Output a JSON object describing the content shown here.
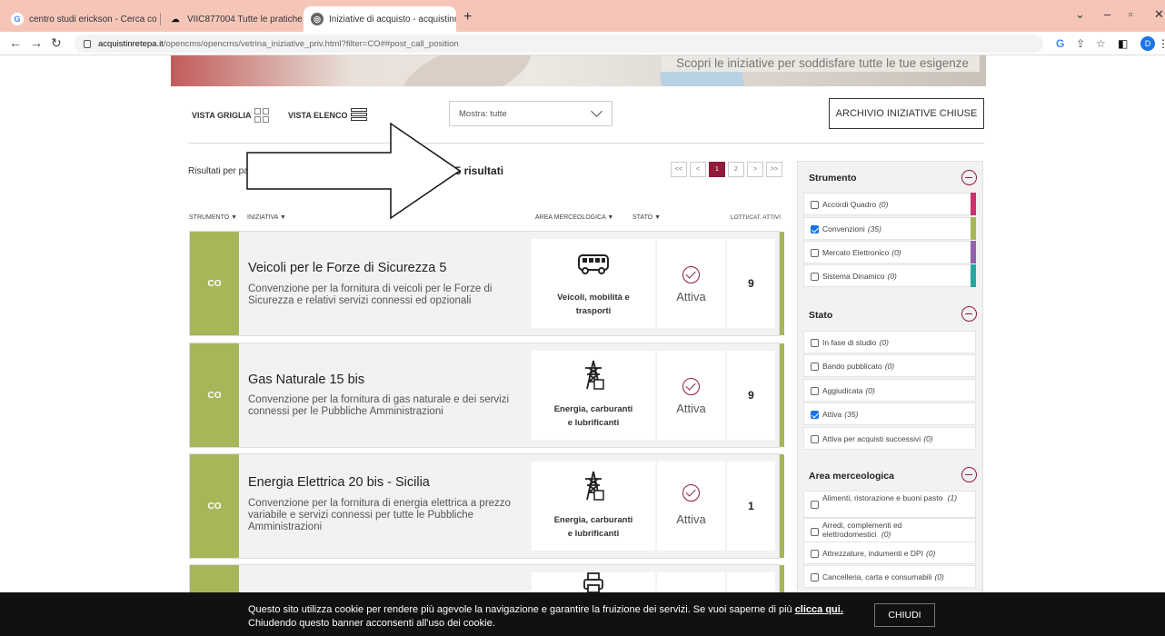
{
  "browser": {
    "tabs": [
      {
        "label": "centro studi erickson - Cerca con"
      },
      {
        "label": "VIIC877004 Tutte le pratiche"
      },
      {
        "label": "Iniziative di acquisto - acquistinr"
      }
    ],
    "url_domain": "acquistinretepa.it",
    "url_path": "/opencms/opencms/vetrina_iniziative_priv.html?filter=CO##post_call_position",
    "profile_initial": "D"
  },
  "banner": {
    "tagline": "Scopri le iniziative per soddisfare tutte le tue esigenze"
  },
  "toolbar": {
    "grid_label": "VISTA GRIGLIA",
    "list_label": "VISTA ELENCO",
    "select_value": "Mostra: tutte",
    "archive_button": "ARCHIVIO INIZIATIVE CHIUSE"
  },
  "results": {
    "per_page_label": "Risultati per pa",
    "count_label": "35 risultati",
    "pager": [
      "<<",
      "<",
      "1",
      "2",
      ">",
      ">>"
    ]
  },
  "columns": {
    "strumento": "STRUMENTO ▼",
    "iniziativa": "INIZIATIVA ▼",
    "area": "AREA MERCEOLOGICA ▼",
    "stato": "STATO ▼",
    "lotti": "LOTTI/CAT. ATTIVI"
  },
  "rows": [
    {
      "code": "CO",
      "title": "Veicoli per le Forze di Sicurezza 5",
      "desc": "Convenzione per la fornitura di veicoli per le Forze di Sicurezza e relativi servizi connessi ed opzionali",
      "area_line1": "Veicoli, mobilità e",
      "area_line2": "trasporti",
      "area_icon": "bus-icon",
      "stato": "Attiva",
      "lotti": "9"
    },
    {
      "code": "CO",
      "title": "Gas Naturale 15 bis",
      "desc": "Convenzione per la fornitura di gas naturale e dei servizi connessi per le Pubbliche Amministrazioni",
      "area_line1": "Energia, carburanti",
      "area_line2": "e lubrificanti",
      "area_icon": "power-pylon-icon",
      "stato": "Attiva",
      "lotti": "9"
    },
    {
      "code": "CO",
      "title": "Energia Elettrica 20 bis - Sicilia",
      "desc": "Convenzione per la fornitura di energia elettrica a prezzo variabile e servizi connessi per tutte le Pubbliche Amministrazioni",
      "area_line1": "Energia, carburanti",
      "area_line2": "e lubrificanti",
      "area_icon": "power-pylon-icon",
      "stato": "Attiva",
      "lotti": "1"
    }
  ],
  "sidebar": {
    "strumento": {
      "title": "Strumento",
      "items": [
        {
          "label": "Accordi Quadro",
          "count": "(0)",
          "checked": false,
          "color": "#c8336e"
        },
        {
          "label": "Convenzioni",
          "count": "(35)",
          "checked": true,
          "color": "#a8b65a"
        },
        {
          "label": "Mercato Elettronico",
          "count": "(0)",
          "checked": false,
          "color": "#9062a8"
        },
        {
          "label": "Sistema Dinamico",
          "count": "(0)",
          "checked": false,
          "color": "#2aa6a0"
        }
      ]
    },
    "stato": {
      "title": "Stato",
      "items": [
        {
          "label": "In fase di studio",
          "count": "(0)",
          "checked": false
        },
        {
          "label": "Bando pubblicato",
          "count": "(0)",
          "checked": false
        },
        {
          "label": "Aggiudicata",
          "count": "(0)",
          "checked": false
        },
        {
          "label": "Attiva",
          "count": "(35)",
          "checked": true
        },
        {
          "label": "Attiva per acquisti successivi",
          "count": "(0)",
          "checked": false
        }
      ]
    },
    "area": {
      "title": "Area merceologica",
      "items": [
        {
          "label": "Alimenti, ristorazione e buoni pasto",
          "count": "(1)",
          "checked": false
        },
        {
          "label": "Arredi, complementi ed elettrodomestici",
          "count": "(0)",
          "checked": false
        },
        {
          "label": "Attrezzature, indumenti e DPI",
          "count": "(0)",
          "checked": false
        },
        {
          "label": "Cancelleria, carta e consumabili",
          "count": "(0)",
          "checked": false
        }
      ]
    }
  },
  "cookie": {
    "line1": "Questo sito utilizza cookie per rendere più agevole la navigazione e garantire la fruizione dei servizi. Se vuoi saperne di più ",
    "link": "clicca qui.",
    "line2": "Chiudendo questo banner acconsenti all'uso dei cookie.",
    "button": "CHIUDI"
  },
  "colors": {
    "accent": "#8f1d3a",
    "convenzioni": "#a8b65a"
  }
}
